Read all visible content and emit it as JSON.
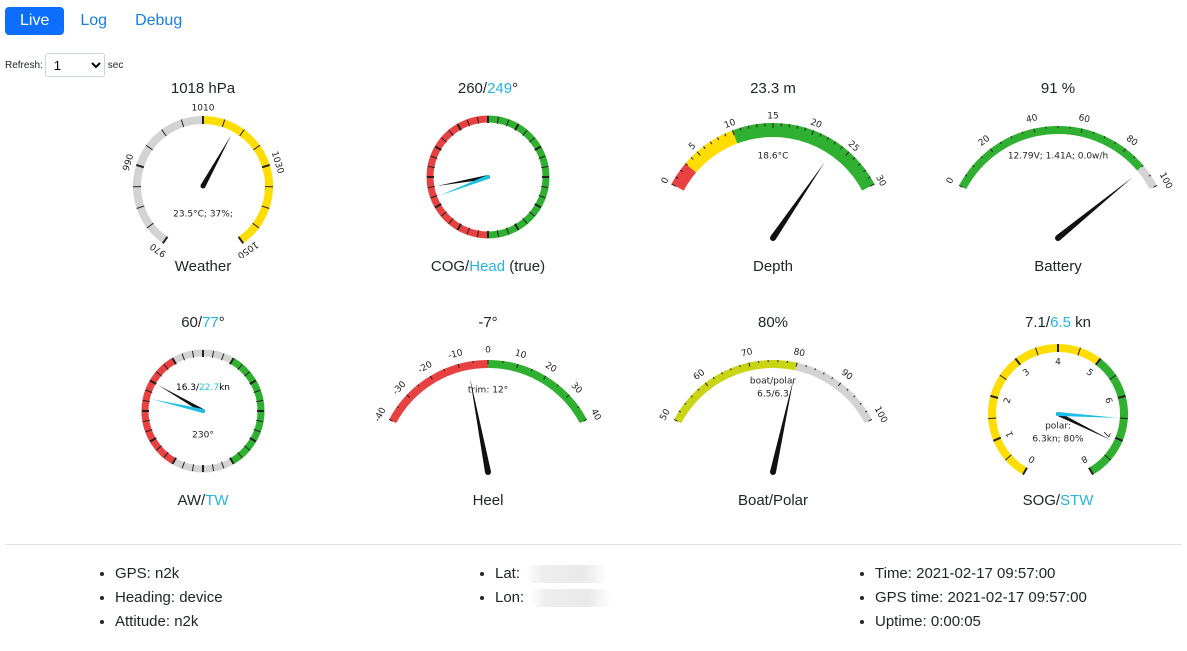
{
  "tabs": [
    {
      "label": "Live"
    },
    {
      "label": "Log"
    },
    {
      "label": "Debug"
    }
  ],
  "refresh": {
    "label": "Refresh:",
    "value": "1",
    "unit": "sec"
  },
  "gauges": {
    "weather": {
      "value": "1018 hPa",
      "name": "Weather",
      "info": "23.5°C; 37%;",
      "ticks": [
        "970",
        "990",
        "1010",
        "1030",
        "1050"
      ],
      "needle_value": 1018,
      "colors": {
        "normal": "#d3d3d3",
        "high": "#ffdd00"
      }
    },
    "cog": {
      "value_a": "260",
      "value_b": "249",
      "value_suffix": "°",
      "name_a": "COG/",
      "name_b": "Head",
      "name_c": " (true)",
      "cog_deg": 260,
      "head_deg": 249,
      "colors": {
        "port": "#e84141",
        "starboard": "#30b030",
        "head": "#1dbde6"
      }
    },
    "depth": {
      "value": "23.3 m",
      "name": "Depth",
      "info": "18.6°C",
      "ticks": [
        "0",
        "5",
        "10",
        "15",
        "20",
        "25",
        "30"
      ],
      "needle_value": 23.3,
      "colors": {
        "shallow": "#e84141",
        "warn": "#ffdd00",
        "ok": "#30b030"
      }
    },
    "battery": {
      "value": "91 %",
      "name": "Battery",
      "info": "12.79V; 1.41A; 0.0w/h",
      "ticks": [
        "0",
        "20",
        "40",
        "60",
        "80",
        "100"
      ],
      "needle_value": 91,
      "colors": {
        "ok": "#30b030",
        "full": "#d3d3d3"
      }
    },
    "aw": {
      "value_a": "60",
      "value_b": "77",
      "value_suffix": "°",
      "name_a": "AW/",
      "name_b": "TW",
      "info_a": "16.3/",
      "info_b": "22.7",
      "info_c": "kn",
      "info_d": "230°",
      "aw_deg": 60,
      "tw_deg": 77,
      "colors": {
        "port": "#e84141",
        "starboard": "#30b030",
        "close": "#d3d3d3",
        "tw": "#1dbde6"
      }
    },
    "heel": {
      "value": "-7°",
      "name": "Heel",
      "info": "trim: 12°",
      "ticks": [
        "-40",
        "-30",
        "-20",
        "-10",
        "0",
        "10",
        "20",
        "30",
        "40"
      ],
      "needle_value": -7,
      "colors": {
        "port": "#e84141",
        "starboard": "#30b030"
      }
    },
    "polar": {
      "value": "80%",
      "name": "Boat/Polar",
      "info_a": "boat/polar",
      "info_b": "6.5/6.3",
      "ticks": [
        "50",
        "60",
        "70",
        "80",
        "90",
        "100"
      ],
      "needle_value": 80,
      "colors": {
        "low": "#c8d414",
        "high": "#d3d3d3"
      }
    },
    "sog": {
      "value_a": "7.1/",
      "value_b": "6.5",
      "value_c": " kn",
      "name_a": "SOG/",
      "name_b": "STW",
      "info_a": "polar:",
      "info_b": "6.3kn; 80%",
      "ticks": [
        "0",
        "1",
        "2",
        "3",
        "4",
        "5",
        "6",
        "7",
        "8"
      ],
      "sog": 7.1,
      "stw": 6.5,
      "colors": {
        "slow": "#ffdd00",
        "fast": "#30b030",
        "stw": "#1dbde6"
      }
    }
  },
  "status": {
    "col1": [
      "GPS: n2k",
      "Heading: device",
      "Attitude: n2k"
    ],
    "col2": [
      "Lat:",
      "Lon:"
    ],
    "col3": [
      "Time: 2021-02-17 09:57:00",
      "GPS time: 2021-02-17 09:57:00",
      "Uptime: 0:00:05"
    ]
  }
}
